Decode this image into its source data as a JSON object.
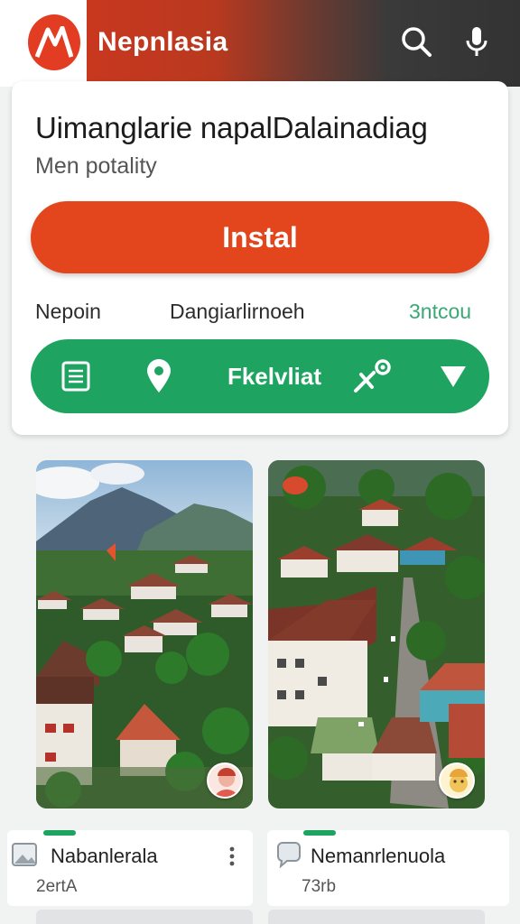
{
  "app": {
    "title": "Nepnlasia"
  },
  "header_icons": [
    "search-icon",
    "microphone-icon"
  ],
  "listing": {
    "title": "Uimanglarie napalDalainadiag",
    "subtitle": "Men potality",
    "install_label": "Instal",
    "meta": [
      "Nepoin",
      "Dangiarlirnoeh",
      "3ntcou"
    ],
    "action_label": "Fkelvliat"
  },
  "tiles": [
    {
      "title": "Nabanlerala",
      "subtitle": "2ertA"
    },
    {
      "title": "Nemanrlenuola",
      "subtitle": "73rb"
    }
  ],
  "colors": {
    "brand": "#e23d22",
    "install": "#e3461d",
    "green": "#1ea460"
  }
}
